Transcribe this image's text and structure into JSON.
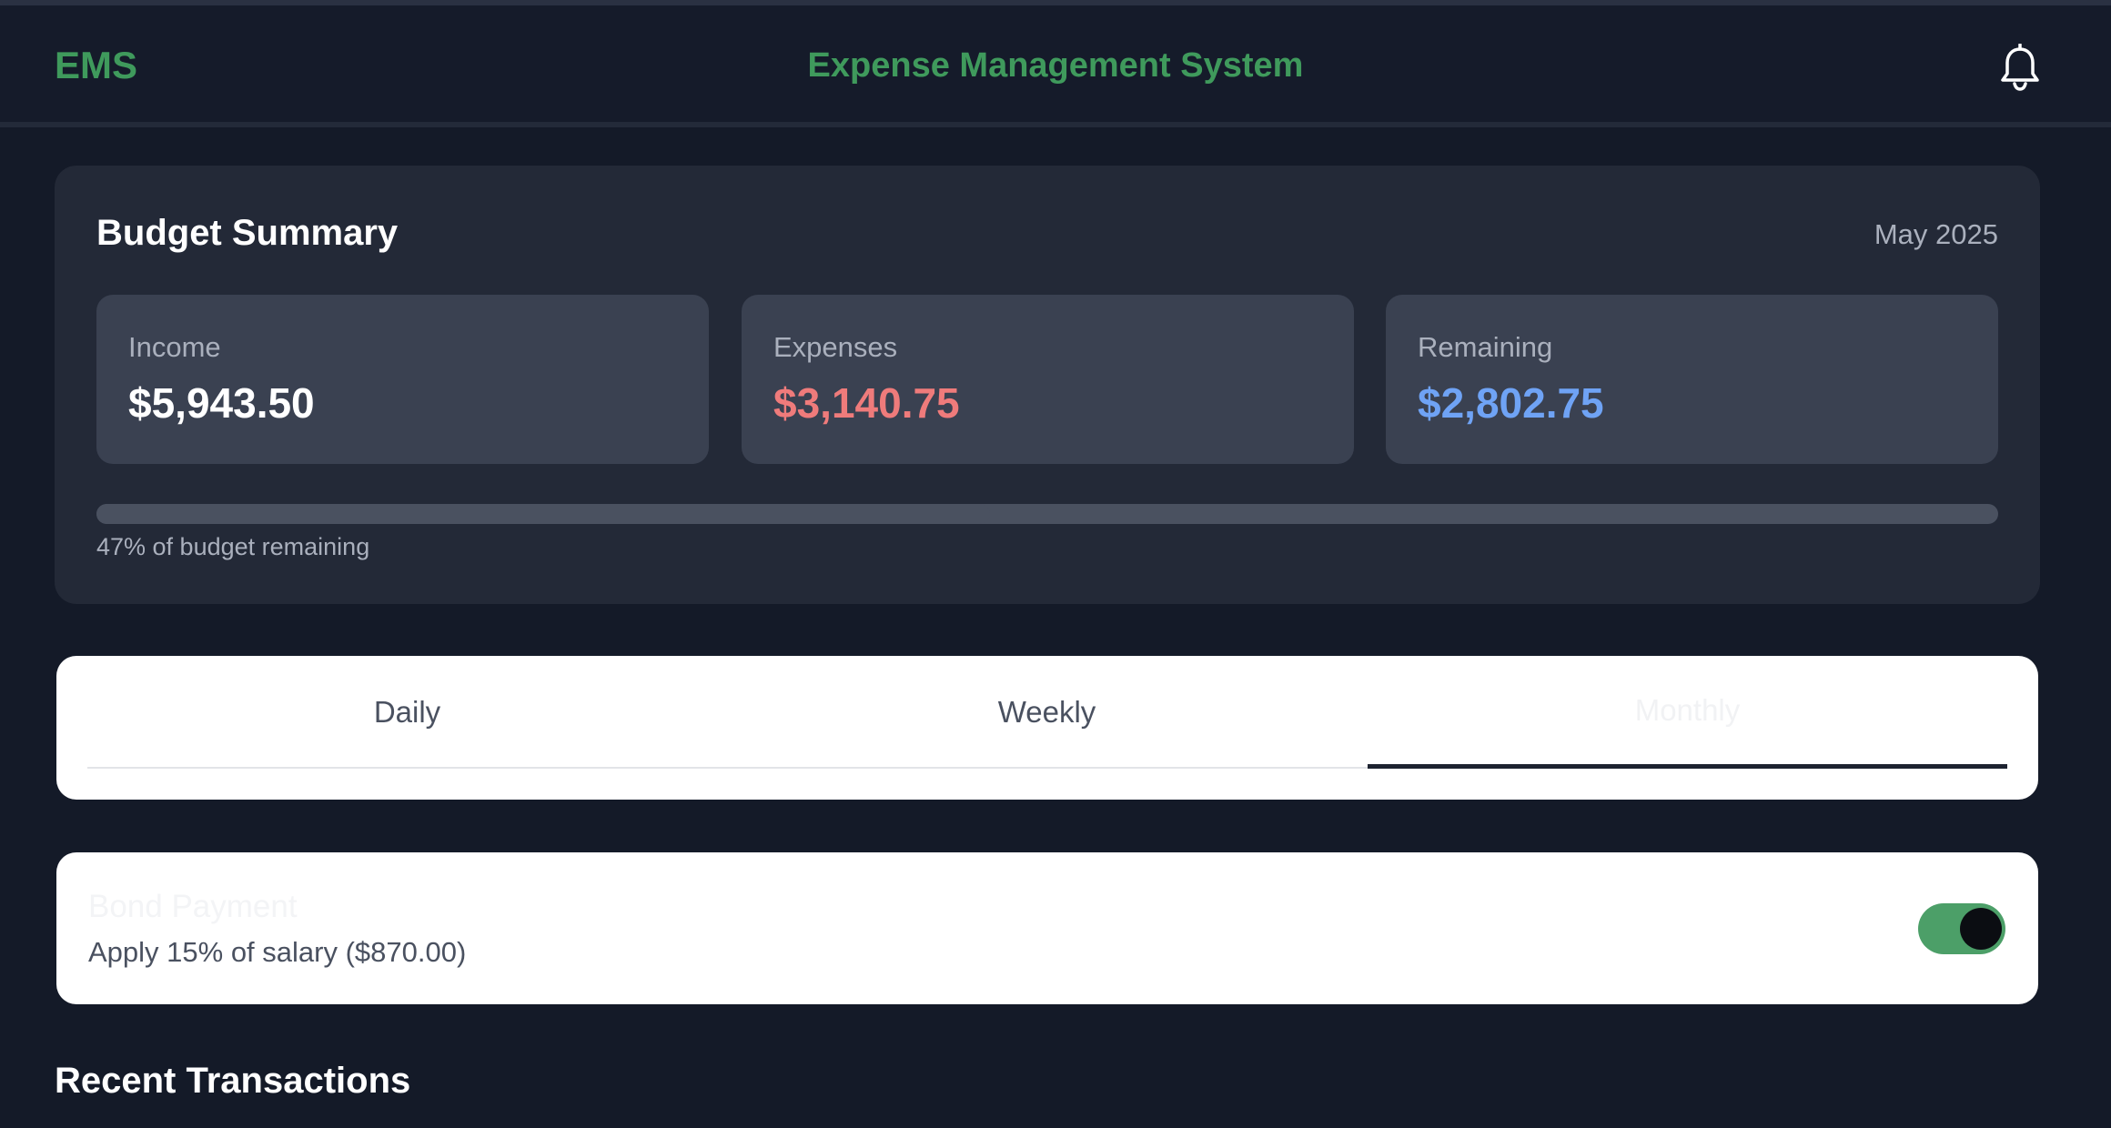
{
  "header": {
    "brand": "EMS",
    "title": "Expense Management System",
    "notification_icon": "bell-icon"
  },
  "summary": {
    "title": "Budget Summary",
    "date": "May 2025",
    "stats": [
      {
        "label": "Income",
        "value": "$5,943.50",
        "color": "#ffffff"
      },
      {
        "label": "Expenses",
        "value": "$3,140.75",
        "color": "#ef7b7b"
      },
      {
        "label": "Remaining",
        "value": "$2,802.75",
        "color": "#6fa3f5"
      }
    ],
    "progress_fraction": 0.47,
    "progress_text": "47% of budget remaining"
  },
  "tabs": [
    {
      "label": "Daily",
      "active": false
    },
    {
      "label": "Weekly",
      "active": false
    },
    {
      "label": "Monthly",
      "active": true
    }
  ],
  "bond": {
    "title": "Bond Payment",
    "description": "Apply 15% of salary ($870.00)",
    "enabled": true
  },
  "recent": {
    "title": "Recent Transactions"
  },
  "colors": {
    "accent": "#3f9a5c",
    "toggle_on": "#4c9f68",
    "background": "#141a28",
    "card": "#232937"
  }
}
